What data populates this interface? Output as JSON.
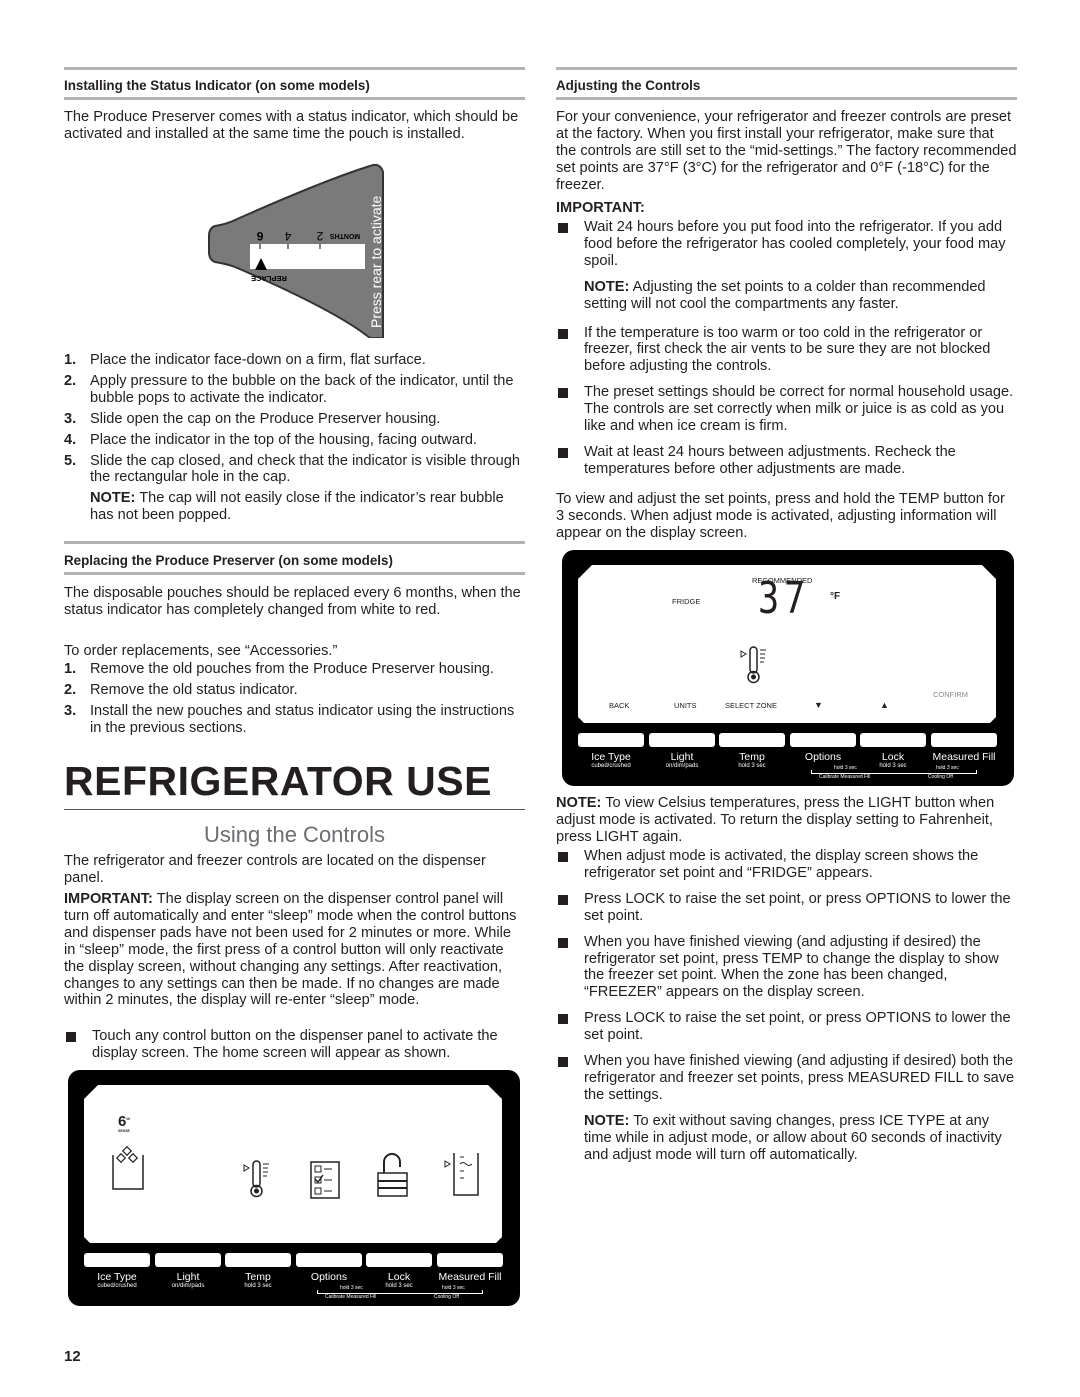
{
  "left": {
    "status_heading": "Installing the Status Indicator (on some models)",
    "status_intro": "The Produce Preserver comes with a status indicator, which should be activated and installed at the same time the pouch is installed.",
    "indicator": {
      "months_label": "MONTHS",
      "ticks": [
        "6",
        "4",
        "2"
      ],
      "replace_label": "REPLACE",
      "side_text": "Press rear to activate"
    },
    "status_steps": [
      {
        "n": "1.",
        "text": "Place the indicator face-down on a firm, flat surface."
      },
      {
        "n": "2.",
        "text": "Apply pressure to the bubble on the back of the indicator, until the bubble pops to activate the indicator."
      },
      {
        "n": "3.",
        "text": "Slide open the cap on the Produce Preserver housing."
      },
      {
        "n": "4.",
        "text": "Place the indicator in the top of the housing, facing outward."
      },
      {
        "n": "5.",
        "text": "Slide the cap closed, and check that the indicator is visible through the rectangular hole in the cap."
      }
    ],
    "status_note_label": "NOTE:",
    "status_note": " The cap will not easily close if the indicator’s rear bubble has not been popped.",
    "replace_heading": "Replacing the Produce Preserver (on some models)",
    "replace_intro": "The disposable pouches should be replaced every 6 months, when the status indicator has completely changed from white to red.",
    "replace_order": "To order replacements, see “Accessories.”",
    "replace_steps": [
      {
        "n": "1.",
        "text": "Remove the old pouches from the Produce Preserver housing."
      },
      {
        "n": "2.",
        "text": "Remove the old status indicator."
      },
      {
        "n": "3.",
        "text": "Install the new pouches and status indicator using the instructions in the previous sections."
      }
    ],
    "section_title": "REFRIGERATOR USE",
    "subsection_title": "Using the Controls",
    "controls_intro": "The refrigerator and freezer controls are located on the dispenser panel.",
    "important_label": "IMPORTANT:",
    "important_text": " The display screen on the dispenser control panel will turn off automatically and enter “sleep” mode when the control buttons and dispenser pads have not been used for 2 minutes or more. While in “sleep” mode, the first press of a control button will only reactivate the display screen, without changing any settings. After reactivation, changes to any settings can then be made. If no changes are made within 2 minutes, the display will re-enter “sleep” mode.",
    "touch_bullet": "Touch any control button on the dispenser panel to activate the display screen. The home screen will appear as shown.",
    "home_panel": {
      "logo_number": "6",
      "logo_sup": "th",
      "logo_sub": "SENSE"
    }
  },
  "panel_buttons": [
    {
      "label": "Ice Type",
      "sub": "cubed/crushed"
    },
    {
      "label": "Light",
      "sub": "on/dim/pads"
    },
    {
      "label": "Temp",
      "sub": "hold 3 sec"
    },
    {
      "label": "Options",
      "sub": ""
    },
    {
      "label": "Lock",
      "sub": "hold 3 sec"
    },
    {
      "label": "Measured Fill",
      "sub": ""
    }
  ],
  "panel_combos": {
    "options_lock": "hold 3 sec",
    "lock_fill": "hold 3 sec",
    "calibrate": "Calibrate Measured Fill",
    "cooling_off": "Cooling Off"
  },
  "right": {
    "adjust_heading": "Adjusting the Controls",
    "adjust_intro": "For your convenience, your refrigerator and freezer controls are preset at the factory. When you first install your refrigerator, make sure that the controls are still set to the “mid-settings.” The factory recommended set points are 37°F (3°C) for the refrigerator and 0°F (-18°C) for the freezer.",
    "important_label": "IMPORTANT:",
    "bullets1": [
      "Wait 24 hours before you put food into the refrigerator. If you add food before the refrigerator has cooled completely, your food may spoil.",
      "If the temperature is too warm or too cold in the refrigerator or freezer, first check the air vents to be sure they are not blocked before adjusting the controls.",
      "The preset settings should be correct for normal household usage. The controls are set correctly when milk or juice is as cold as you like and when ice cream is firm.",
      "Wait at least 24 hours between adjustments. Recheck the temperatures before other adjustments are made."
    ],
    "bullet1_note_label": "NOTE:",
    "bullet1_note": " Adjusting the set points to a colder than recommended setting will not cool the compartments any faster.",
    "view_adjust": "To view and adjust the set points, press and hold the TEMP button for 3 seconds. When adjust mode is activated, adjusting information will appear on the display screen.",
    "adjust_panel": {
      "recommended": "RECOMMENDED",
      "zone": "FRIDGE",
      "temperature": "37",
      "unit": "°F",
      "confirm": "CONFIRM",
      "soft_keys": [
        "BACK",
        "UNITS",
        "SELECT ZONE"
      ],
      "down_arrow": "▼",
      "up_arrow": "▲"
    },
    "celsius_note_label": "NOTE:",
    "celsius_note": " To view Celsius temperatures, press the LIGHT button when adjust mode is activated. To return the display setting to Fahrenheit, press LIGHT again.",
    "bullets2": [
      "When adjust mode is activated, the display screen shows the refrigerator set point and “FRIDGE” appears.",
      "Press LOCK to raise the set point, or press OPTIONS to lower the set point.",
      "When you have finished viewing (and adjusting if desired) the refrigerator set point, press TEMP to change the display to show the freezer set point. When the zone has been changed, “FREEZER” appears on the display screen.",
      "Press LOCK to raise the set point, or press OPTIONS to lower the set point.",
      "When you have finished viewing (and adjusting if desired) both the refrigerator and freezer set points, press MEASURED FILL to save the settings."
    ],
    "exit_note_label": "NOTE:",
    "exit_note": " To exit without saving changes, press ICE TYPE at any time while in adjust mode, or allow about 60 seconds of inactivity and adjust mode will turn off automatically."
  },
  "page_number": "12"
}
